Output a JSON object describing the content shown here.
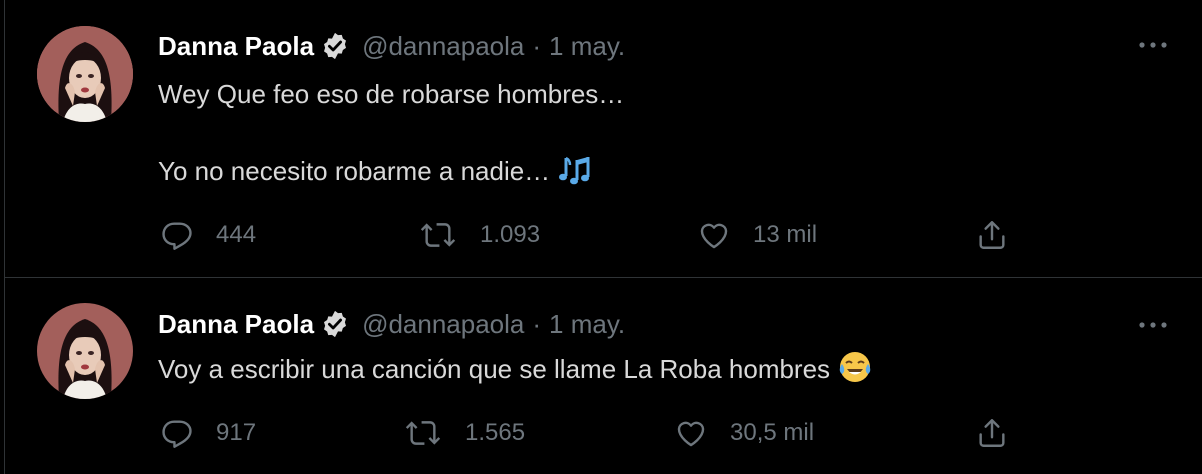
{
  "tweets": [
    {
      "author_name": "Danna Paola",
      "handle": "@dannapaola",
      "separator": "·",
      "date": "1 may.",
      "text_lines": [
        "Wey Que feo eso de robarse hombres…",
        "Yo no necesito robarme a nadie…"
      ],
      "emoji_icon": "musical-notes-icon",
      "replies": "444",
      "retweets": "1.093",
      "likes": "13 mil"
    },
    {
      "author_name": "Danna Paola",
      "handle": "@dannapaola",
      "separator": "·",
      "date": "1 may.",
      "text_lines": [
        "Voy a escribir una canción que se llame La Roba hombres"
      ],
      "emoji_icon": "tears-of-joy-face-icon",
      "replies": "917",
      "retweets": "1.565",
      "likes": "30,5 mil"
    }
  ],
  "colors": {
    "background": "#000000",
    "primary_text": "#d9d9d9",
    "name_text": "#ffffff",
    "secondary_text": "#6e767d",
    "divider": "#2f3336",
    "emoji_blue": "#5aaae8"
  },
  "icons": {
    "verified": "verified-badge-icon",
    "more": "more-options-icon",
    "reply": "reply-icon",
    "retweet": "retweet-icon",
    "like": "heart-icon",
    "share": "share-icon"
  }
}
